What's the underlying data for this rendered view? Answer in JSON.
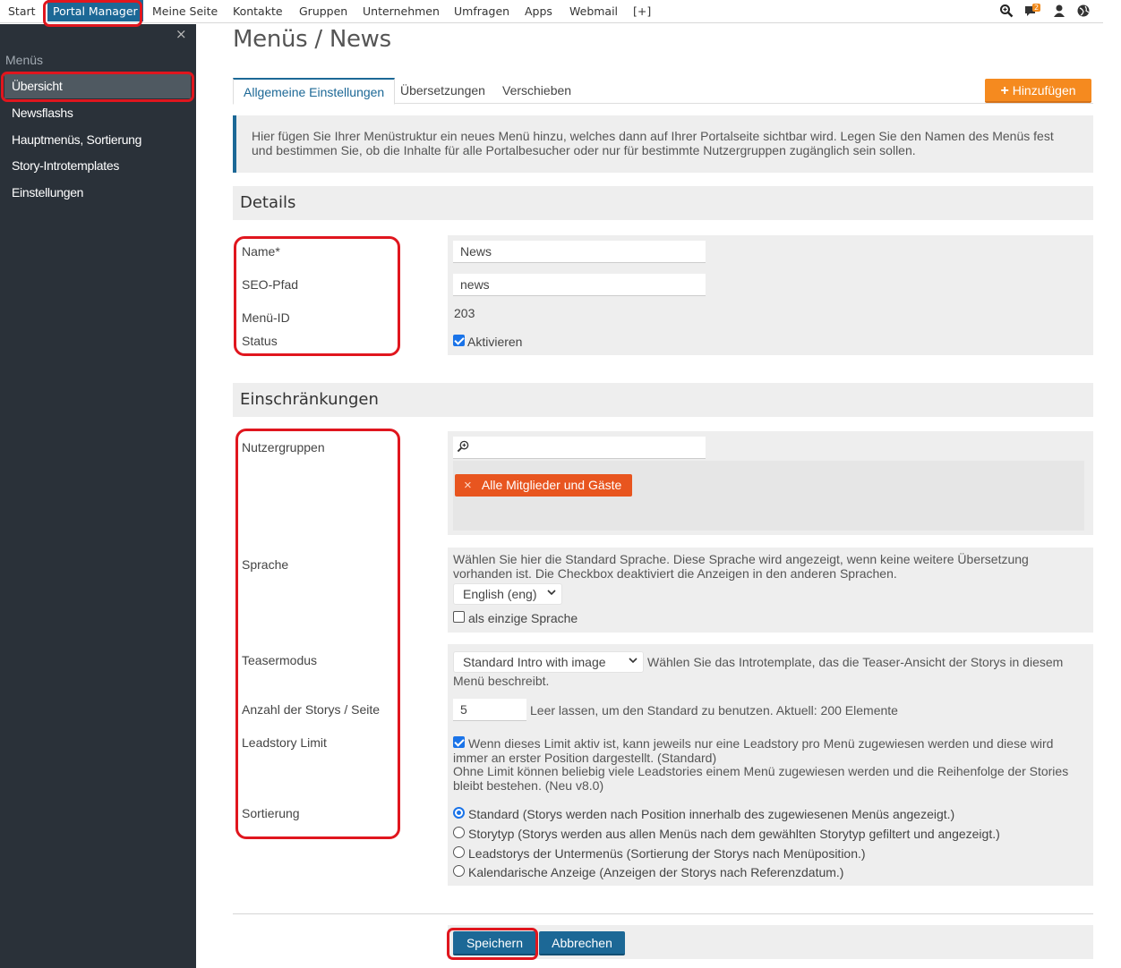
{
  "topnav": {
    "items": [
      "Start",
      "Portal Manager",
      "Meine Seite",
      "Kontakte",
      "Gruppen",
      "Unternehmen",
      "Umfragen",
      "Apps",
      "Webmail",
      "[+]"
    ],
    "notification_count": "2",
    "icons": [
      "search-icon",
      "chat-icon",
      "user-icon",
      "globe-icon"
    ]
  },
  "sidebar": {
    "close_symbol": "×",
    "heading": "Menüs",
    "items": [
      "Übersicht",
      "Newsflashs",
      "Hauptmenüs, Sortierung",
      "Story-Introtemplates",
      "Einstellungen"
    ]
  },
  "main": {
    "title": "Menüs / News",
    "tabs": [
      "Allgemeine Einstellungen",
      "Übersetzungen",
      "Verschieben"
    ],
    "add_button": "Hinzufügen",
    "info_text": "Hier fügen Sie Ihrer Menüstruktur ein neues Menü hinzu, welches dann auf Ihrer Portalseite sichtbar wird. Legen Sie den Namen des Menüs fest und bestimmen Sie, ob die Inhalte für alle Portalbesucher oder nur für bestimmte Nutzergruppen zugänglich sein sollen."
  },
  "details": {
    "heading": "Details",
    "name_label": "Name*",
    "name_value": "News",
    "seo_label": "SEO-Pfad",
    "seo_value": "news",
    "menu_id_label": "Menü-ID",
    "menu_id_value": "203",
    "status_label": "Status",
    "status_checkbox": "Aktivieren"
  },
  "restrictions": {
    "heading": "Einschränkungen",
    "groups_label": "Nutzergruppen",
    "groups_tag": "Alle Mitglieder und Gäste",
    "language_label": "Sprache",
    "language_help": "Wählen Sie hier die Standard Sprache. Diese Sprache wird angezeigt, wenn keine weitere Übersetzung vorhanden ist. Die Checkbox deaktiviert die Anzeigen in den anderen Sprachen.",
    "language_value": "English (eng)",
    "language_only": "als einzige Sprache",
    "teaser_label": "Teasermodus",
    "teaser_value": "Standard Intro with image",
    "teaser_help_1": "Wählen Sie das Introtemplate, das die Teaser-Ansicht der Storys in diesem",
    "teaser_help_2": "Menü beschreibt.",
    "count_label": "Anzahl der Storys / Seite",
    "count_value": "5",
    "count_help": "Leer lassen, um den Standard zu benutzen. Aktuell: 200 Elemente",
    "leadstory_label": "Leadstory Limit",
    "leadstory_text": "Wenn dieses Limit aktiv ist, kann jeweils nur eine Leadstory pro Menü zugewiesen werden und diese wird immer an erster Position dargestellt. (Standard)",
    "leadstory_text_2": "Ohne Limit können beliebig viele Leadstories einem Menü zugewiesen werden und die Reihenfolge der Stories bleibt bestehen. (Neu v8.0)",
    "sort_label": "Sortierung",
    "sort_options": [
      "Standard (Storys werden nach Position innerhalb des zugewiesenen Menüs angezeigt.)",
      "Storytyp (Storys werden aus allen Menüs nach dem gewählten Storytyp gefiltert und angezeigt.)",
      "Leadstorys der Untermenüs (Sortierung der Storys nach Menüposition.)",
      "Kalendarische Anzeige (Anzeigen der Storys nach Referenzdatum.)"
    ],
    "sort_selected": "Standard (Storys werden nach Position innerhalb des zugewiesenen Menüs angezeigt.)"
  },
  "actions": {
    "save": "Speichern",
    "cancel": "Abbrechen"
  },
  "colors": {
    "primary": "#1c6896",
    "sidebar_bg": "#2a3139",
    "add_button": "#f58a1f",
    "tag": "#e8551f",
    "annotation": "#e0161e"
  }
}
